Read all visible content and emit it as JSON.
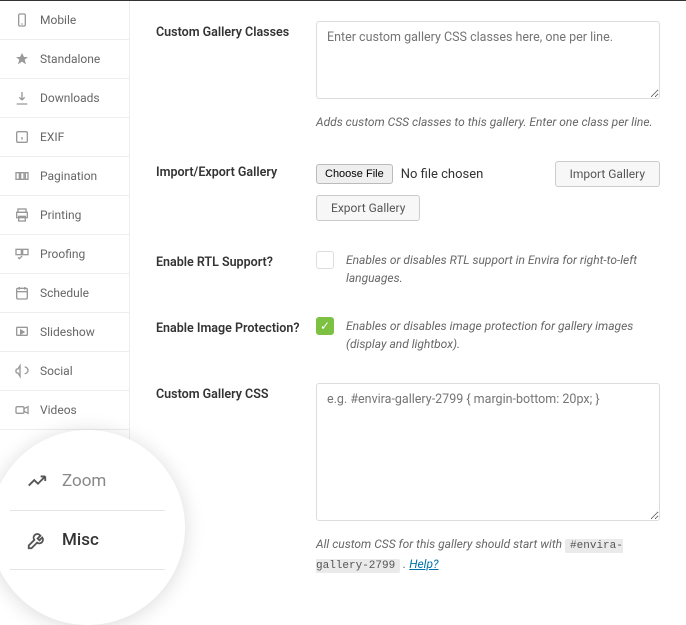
{
  "sidebar": {
    "items": [
      {
        "label": "Mobile"
      },
      {
        "label": "Standalone"
      },
      {
        "label": "Downloads"
      },
      {
        "label": "EXIF"
      },
      {
        "label": "Pagination"
      },
      {
        "label": "Printing"
      },
      {
        "label": "Proofing"
      },
      {
        "label": "Schedule"
      },
      {
        "label": "Slideshow"
      },
      {
        "label": "Social"
      },
      {
        "label": "Videos"
      }
    ]
  },
  "fields": {
    "custom_classes": {
      "label": "Custom Gallery Classes",
      "placeholder": "Enter custom gallery CSS classes here, one per line.",
      "help": "Adds custom CSS classes to this gallery. Enter one class per line."
    },
    "import_export": {
      "label": "Import/Export Gallery",
      "choose_file": "Choose File",
      "no_file": "No file chosen",
      "import_btn": "Import Gallery",
      "export_btn": "Export Gallery"
    },
    "rtl": {
      "label": "Enable RTL Support?",
      "help": "Enables or disables RTL support in Envira for right-to-left languages."
    },
    "protection": {
      "label": "Enable Image Protection?",
      "help": "Enables or disables image protection for gallery images (display and lightbox)."
    },
    "custom_css": {
      "label": "Custom Gallery CSS",
      "placeholder": "e.g. #envira-gallery-2799 { margin-bottom: 20px; }",
      "help_prefix": "All custom CSS for this gallery should start with ",
      "help_tag": "#envira-gallery-2799",
      "help_suffix": " . ",
      "help_link": "Help?"
    }
  },
  "magnify": {
    "zoom": "Zoom",
    "misc": "Misc"
  }
}
